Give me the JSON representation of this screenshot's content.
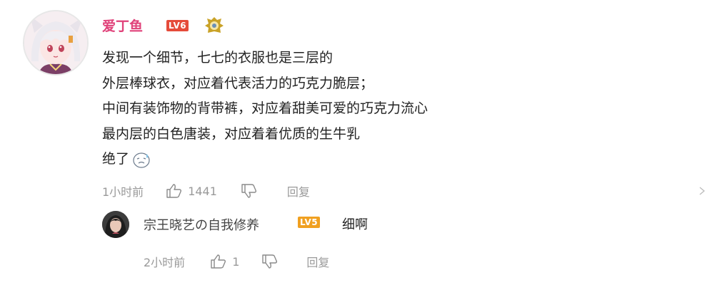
{
  "comment": {
    "username": "爱丁鱼",
    "level_badge": "LV6",
    "lines": [
      "发现一个细节，七七的衣服也是三层的",
      "外层棒球衣，对应着代表活力的巧克力脆层；",
      "中间有装饰物的背带裤，对应着甜美可爱的巧克力流心",
      "最内层的白色唐装，对应着着优质的生牛乳",
      "绝了"
    ],
    "time": "1小时前",
    "likes": "1441",
    "reply_label": "回复"
  },
  "reply": {
    "username": "宗王晓艺の自我修养",
    "level_badge": "LV5",
    "text": "细啊",
    "time": "2小时前",
    "likes": "1",
    "reply_label": "回复"
  },
  "icons": {
    "like": "thumbs-up-icon",
    "dislike": "thumbs-down-icon",
    "emoji": "sweat-smile-emoji-icon",
    "medal": "fan-medal-icon"
  },
  "colors": {
    "username": "#e0427a",
    "lv6": "#e54b3a",
    "lv5": "#f0a020",
    "meta": "#9a9a9a"
  }
}
